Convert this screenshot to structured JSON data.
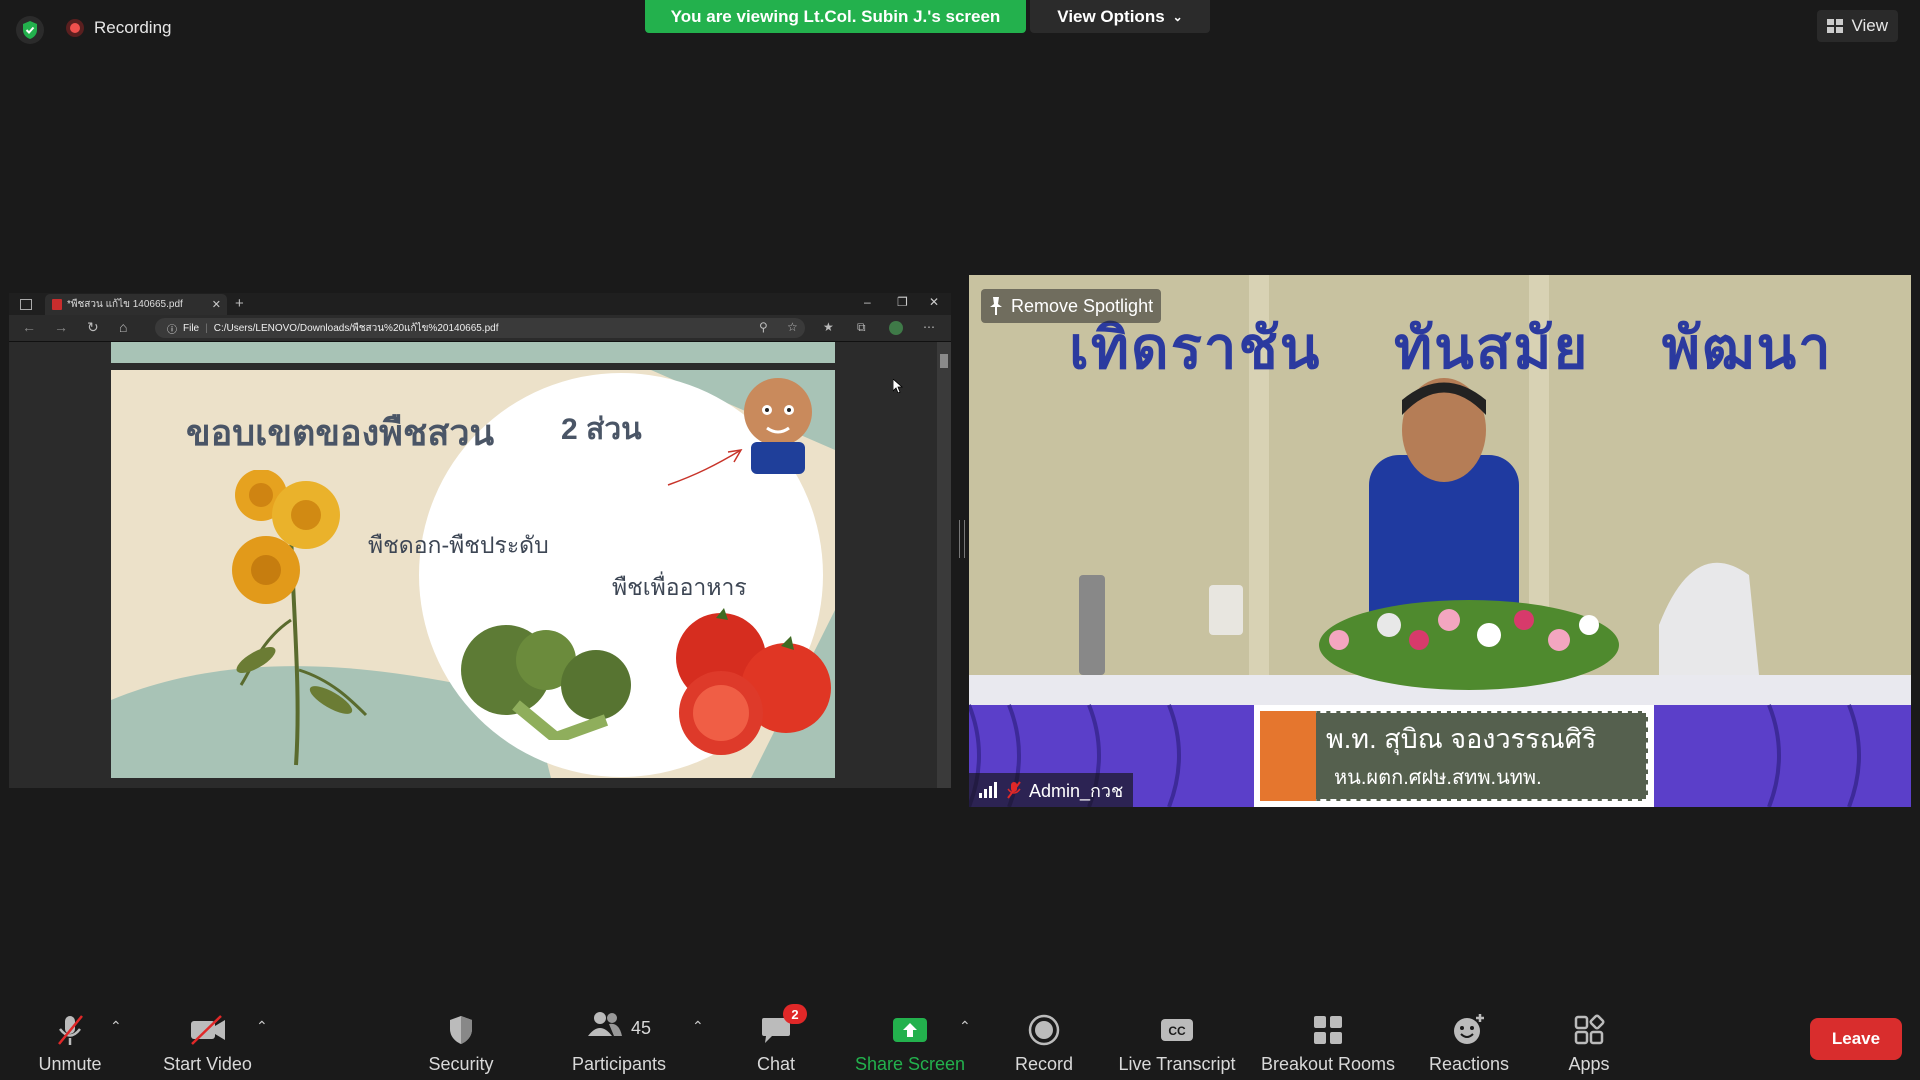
{
  "top": {
    "recording_label": "Recording",
    "viewing_banner": "You are viewing Lt.Col. Subin J.'s screen",
    "view_options_label": "View Options",
    "view_label": "View"
  },
  "shared_screen": {
    "tab_title": "*พืชสวน แก้ไข 140665.pdf",
    "url_scheme": "File",
    "url": "C:/Users/LENOVO/Downloads/พืชสวน%20แก้ไข%20140665.pdf",
    "slide": {
      "title": "ขอบเขตของพืชสวน",
      "count": "2 ส่วน",
      "label_flower": "พืชดอก-พืชประดับ",
      "label_food": "พืชเพื่ออาหาร"
    }
  },
  "video": {
    "remove_spotlight_label": "Remove Spotlight",
    "participant_name": "Admin_กวช",
    "banner_words": [
      "เทิดราชัน",
      "ทันสมัย",
      "พัฒนา"
    ],
    "name_sign_line1": "พ.ท. สุบิณ  จองวรรณศิริ",
    "name_sign_line2": "หน.ผตก.ศฝษ.สทพ.นทพ."
  },
  "toolbar": {
    "unmute": "Unmute",
    "start_video": "Start Video",
    "security": "Security",
    "participants": "Participants",
    "participants_count": "45",
    "chat": "Chat",
    "chat_badge": "2",
    "share_screen": "Share Screen",
    "record": "Record",
    "live_transcript": "Live Transcript",
    "breakout_rooms": "Breakout Rooms",
    "reactions": "Reactions",
    "apps": "Apps",
    "leave": "Leave"
  },
  "colors": {
    "share_green": "#23b14d",
    "leave_red": "#d92d2d",
    "badge_red": "#e02828"
  }
}
